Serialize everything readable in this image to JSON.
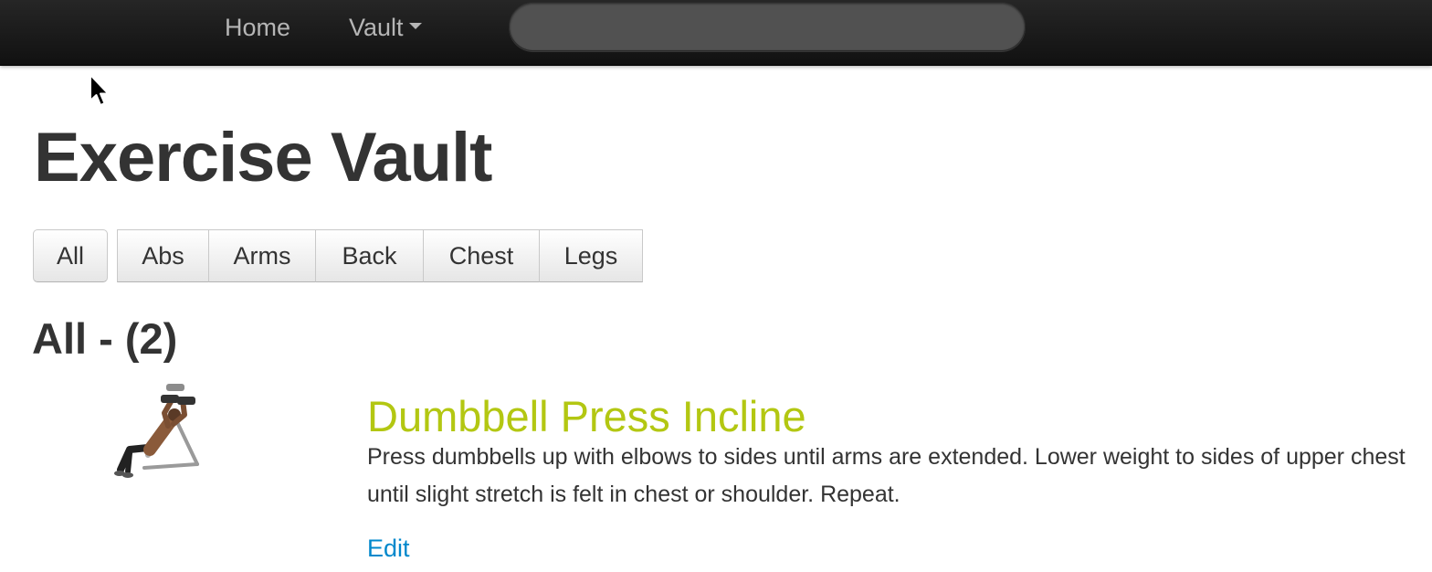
{
  "nav": {
    "home_label": "Home",
    "vault_label": "Vault",
    "search_value": ""
  },
  "page": {
    "title": "Exercise Vault"
  },
  "filters": {
    "all": "All",
    "abs": "Abs",
    "arms": "Arms",
    "back": "Back",
    "chest": "Chest",
    "legs": "Legs"
  },
  "section": {
    "heading": "All - (2)"
  },
  "exercises": [
    {
      "title": "Dumbbell Press Incline",
      "description": "Press dumbbells up with elbows to sides until arms are extended. Lower weight to sides of upper chest until slight stretch is felt in chest or shoulder. Repeat.",
      "edit_label": "Edit",
      "image_icon": "incline-dumbbell-press-figure"
    }
  ],
  "colors": {
    "exercise_title": "#b3c712",
    "link": "#0088cc",
    "navbar": "#1b1b1b"
  }
}
